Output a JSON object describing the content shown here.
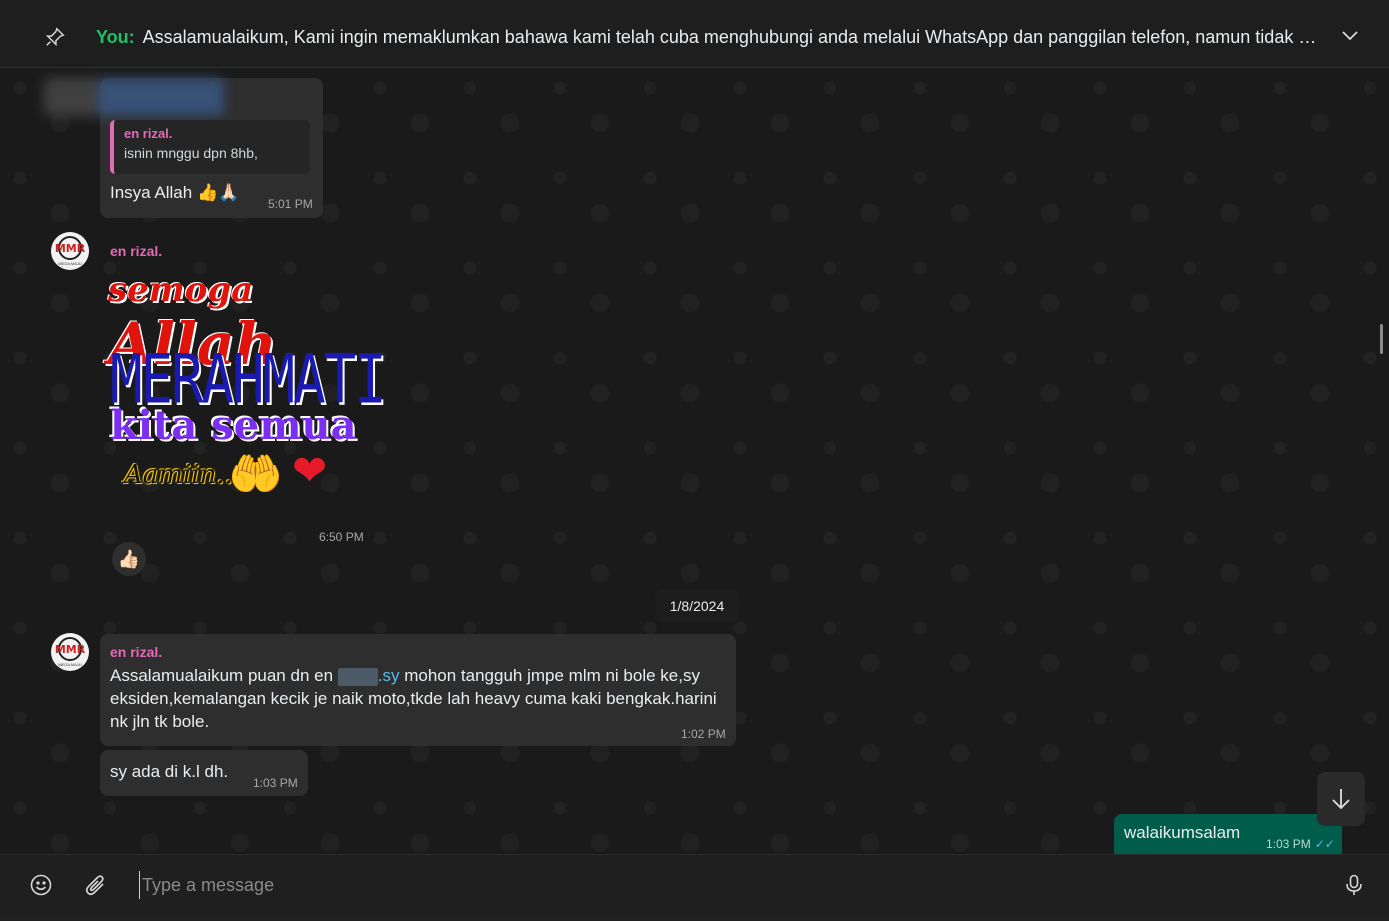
{
  "pinned": {
    "sender": "You:",
    "text": "Assalamualaikum,  Kami ingin memaklumkan bahawa kami telah cuba menghubungi anda melalui WhatsApp dan panggilan telefon, namun tidak mener..."
  },
  "messages": {
    "m1": {
      "quote_name": "en rizal.",
      "quote_text": "isnin mnggu dpn 8hb,",
      "text": "Insya Allah 👍🙏🏻",
      "time": "5:01 PM"
    },
    "m2": {
      "sender": "en rizal.",
      "sticker_line1_a": "semoga",
      "sticker_line1_b": "Allah",
      "sticker_line2": "MERAHMATI",
      "sticker_line3": "kita semua",
      "sticker_line4": "Aamiin..",
      "sticker_hands": "🤲",
      "sticker_heart": "❤",
      "time": "6:50 PM",
      "reaction": "👍🏻"
    },
    "date_divider": "1/8/2024",
    "m3": {
      "sender": "en rizal.",
      "text_before": "Assalamualaikum puan dn en ",
      "link_text": ".sy",
      "text_after": " mohon tangguh jmpe mlm ni bole ke,sy eksiden,kemalangan kecik je naik moto,tkde lah heavy cuma kaki bengkak.harini nk jln tk bole.",
      "time": "1:02 PM"
    },
    "m4": {
      "text": "sy ada di k.l dh.",
      "time": "1:03 PM"
    },
    "m5": {
      "text": "walaikumsalam",
      "time": "1:03 PM",
      "ticks": "✓✓"
    }
  },
  "avatar": {
    "logo_text": "MMR",
    "sub_text": "MEGA MAJU"
  },
  "composer": {
    "placeholder": "Type a message"
  },
  "icons": {
    "pin": "pin-icon",
    "chevron": "chevron-down-icon",
    "scroll_down": "arrow-down-icon",
    "emoji": "emoji-icon",
    "attach": "paperclip-icon",
    "mic": "microphone-icon"
  },
  "colors": {
    "you_label": "#21c063",
    "sender_name": "#e26ab6",
    "outgoing_bubble": "#005c4b",
    "incoming_bubble": "#2e2e2e",
    "read_ticks": "#53bdeb"
  }
}
